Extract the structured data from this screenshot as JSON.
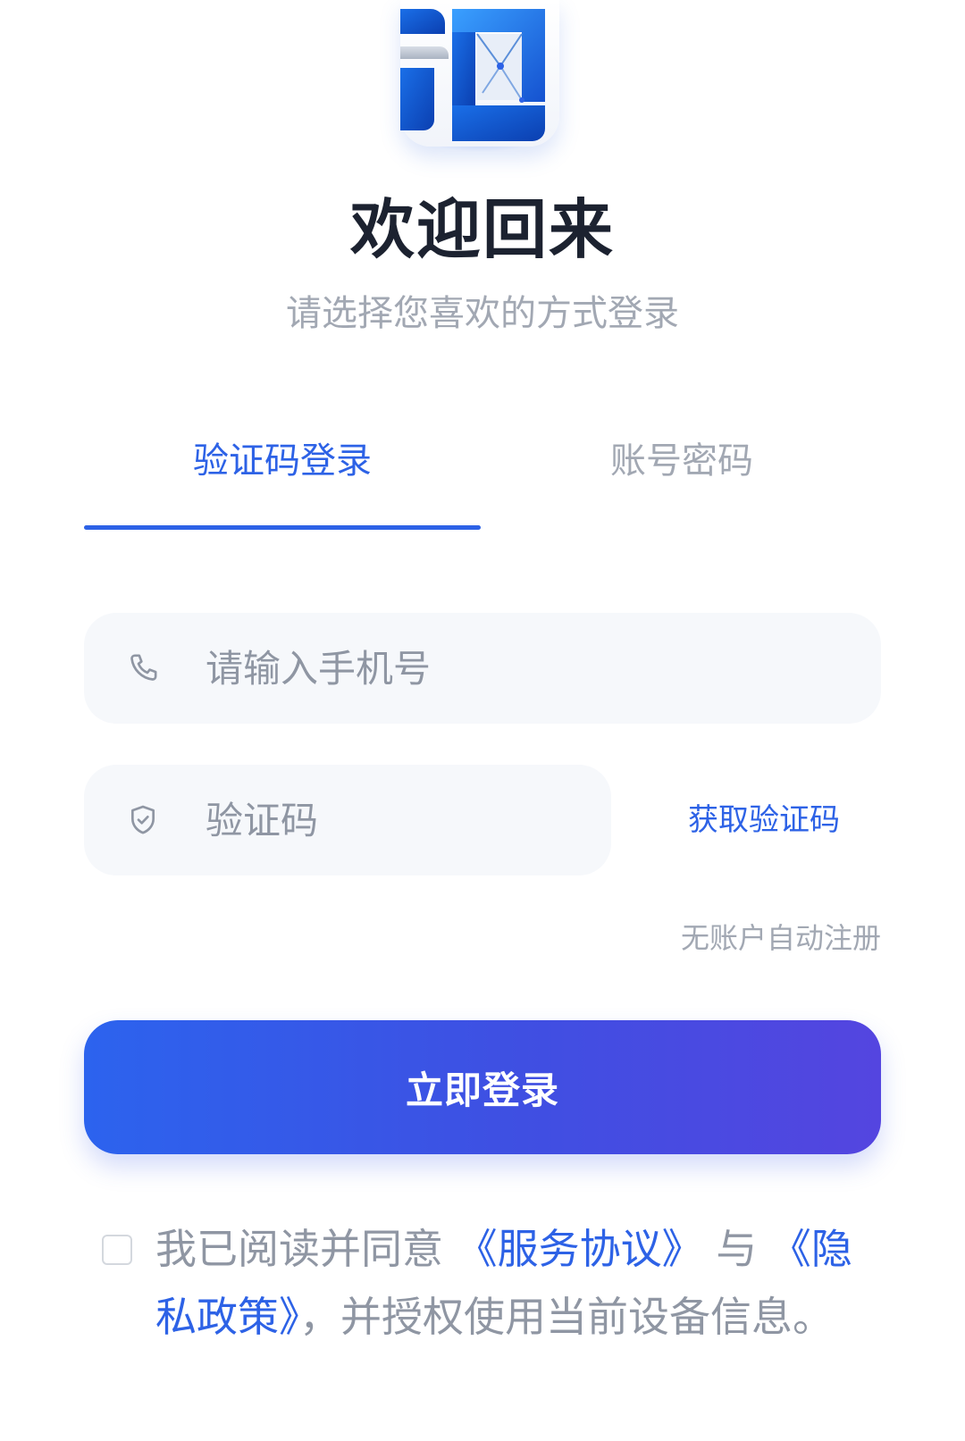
{
  "logo": {
    "name": "app-logo"
  },
  "header": {
    "title": "欢迎回来",
    "subtitle": "请选择您喜欢的方式登录"
  },
  "tabs": [
    {
      "label": "验证码登录",
      "active": true
    },
    {
      "label": "账号密码",
      "active": false
    }
  ],
  "form": {
    "phone": {
      "placeholder": "请输入手机号",
      "value": "",
      "icon": "phone-icon"
    },
    "code": {
      "placeholder": "验证码",
      "value": "",
      "icon": "shield-check-icon"
    },
    "get_code_label": "获取验证码",
    "auto_register_hint": "无账户自动注册",
    "submit_label": "立即登录"
  },
  "agreement": {
    "checked": false,
    "prefix": "我已阅读并同意",
    "service_link": "《服务协议》",
    "conjunction": "与",
    "privacy_link": "《隐私政策》",
    "suffix": "，并授权使用当前设备信息。"
  },
  "colors": {
    "accent": "#2d62e6",
    "button_gradient_start": "#2c63ee",
    "button_gradient_end": "#5445e0",
    "title": "#1c2230",
    "muted": "#a2a8b3",
    "field_bg": "#f6f8fb"
  }
}
